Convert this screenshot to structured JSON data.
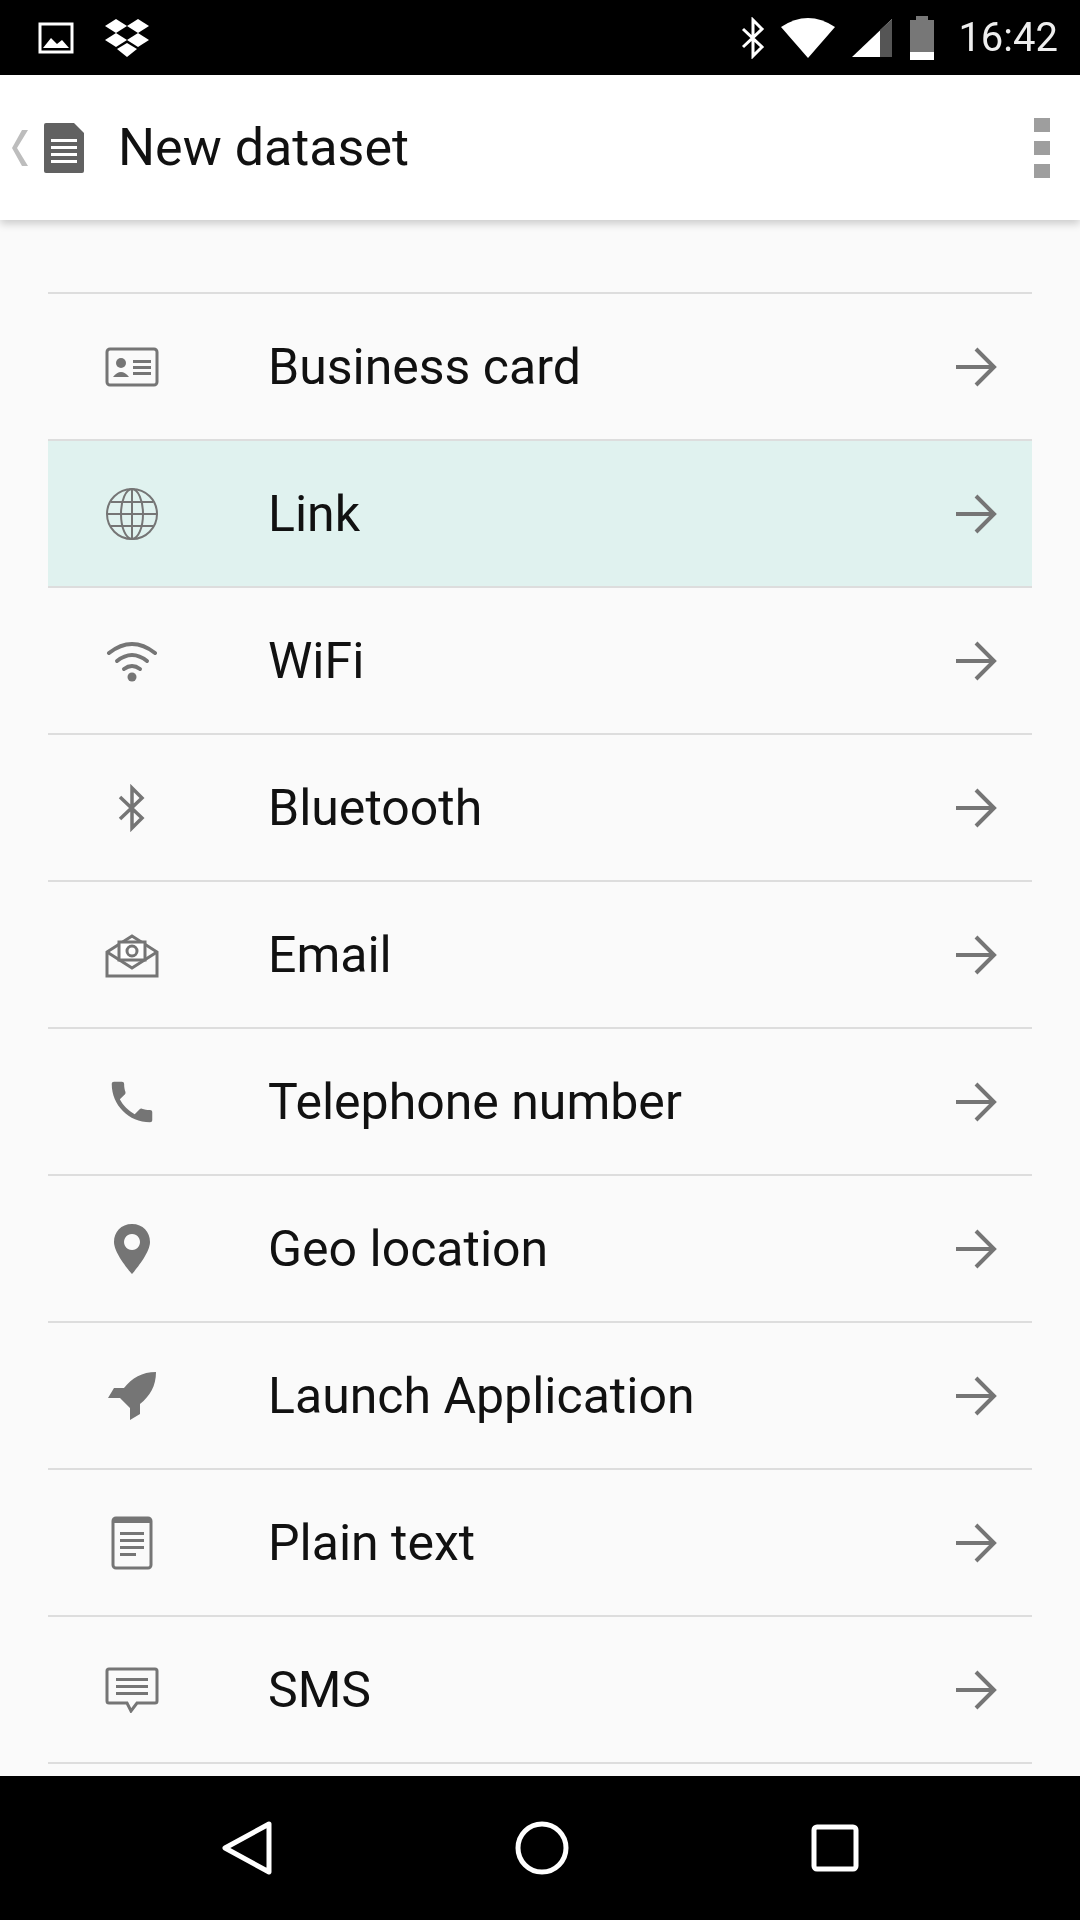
{
  "status_bar": {
    "time": "16:42"
  },
  "app_bar": {
    "title": "New dataset"
  },
  "items": [
    {
      "label": "Business card",
      "kind": "card",
      "selected": false
    },
    {
      "label": "Link",
      "kind": "globe",
      "selected": true
    },
    {
      "label": "WiFi",
      "kind": "wifi",
      "selected": false
    },
    {
      "label": "Bluetooth",
      "kind": "bluetooth",
      "selected": false
    },
    {
      "label": "Email",
      "kind": "email",
      "selected": false
    },
    {
      "label": "Telephone number",
      "kind": "phone",
      "selected": false
    },
    {
      "label": "Geo location",
      "kind": "pin",
      "selected": false
    },
    {
      "label": "Launch Application",
      "kind": "rocket",
      "selected": false
    },
    {
      "label": "Plain text",
      "kind": "doc",
      "selected": false
    },
    {
      "label": "SMS",
      "kind": "sms",
      "selected": false
    }
  ]
}
